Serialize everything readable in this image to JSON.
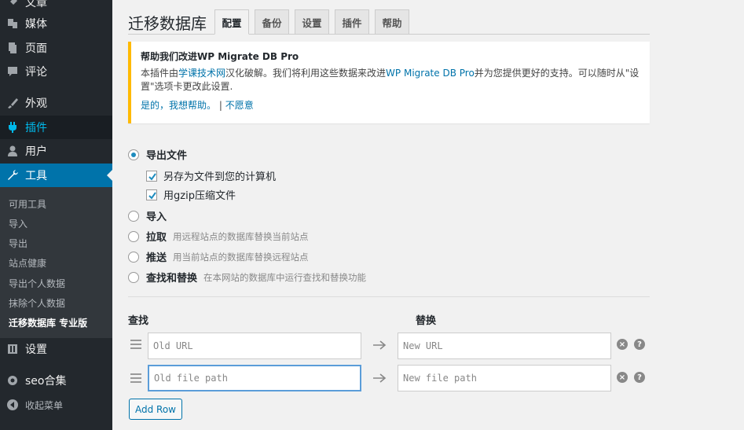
{
  "sidebar": {
    "items": [
      {
        "label": "文章"
      },
      {
        "label": "媒体"
      },
      {
        "label": "页面"
      },
      {
        "label": "评论"
      },
      {
        "label": "外观"
      },
      {
        "label": "插件"
      },
      {
        "label": "用户"
      },
      {
        "label": "工具"
      },
      {
        "label": "设置"
      },
      {
        "label": "seo合集"
      },
      {
        "label": "收起菜单"
      }
    ],
    "submenu": [
      {
        "label": "可用工具"
      },
      {
        "label": "导入"
      },
      {
        "label": "导出"
      },
      {
        "label": "站点健康"
      },
      {
        "label": "导出个人数据"
      },
      {
        "label": "抹除个人数据"
      },
      {
        "label": "迁移数据库 专业版"
      }
    ]
  },
  "page": {
    "title": "迁移数据库",
    "tabs": [
      {
        "label": "配置"
      },
      {
        "label": "备份"
      },
      {
        "label": "设置"
      },
      {
        "label": "插件"
      },
      {
        "label": "帮助"
      }
    ]
  },
  "notice": {
    "title": "帮助我们改进WP Migrate DB Pro",
    "text_1": "本插件由",
    "link_1": "学课技术网",
    "text_2": "汉化破解。我们将利用这些数据来改进",
    "link_2": "WP Migrate DB Pro",
    "text_3": "并为您提供更好的支持。可以随时从\"设置\"选项卡更改此设置.",
    "yes": "是的，我想帮助。",
    "separator": " | ",
    "no": "不愿意"
  },
  "options": {
    "export": {
      "label": "导出文件",
      "selected": true
    },
    "save_to_computer": {
      "label": "另存为文件到您的计算机",
      "checked": true
    },
    "gzip": {
      "label": "用gzip压缩文件",
      "checked": true
    },
    "import": {
      "label": "导入"
    },
    "pull": {
      "label": "拉取",
      "desc": "用远程站点的数据库替换当前站点"
    },
    "push": {
      "label": "推送",
      "desc": "用当前站点的数据库替换远程站点"
    },
    "find_replace": {
      "label": "查找和替换",
      "desc": "在本网站的数据库中运行查找和替换功能"
    }
  },
  "find_replace": {
    "find_header": "查找",
    "replace_header": "替换",
    "rows": [
      {
        "find_placeholder": "Old URL",
        "replace_placeholder": "New URL"
      },
      {
        "find_placeholder": "Old file path",
        "replace_placeholder": "New file path"
      }
    ],
    "remove_icon": "×",
    "help_icon": "?",
    "add_row": "Add Row"
  },
  "colors": {
    "sidebar_bg": "#23282d",
    "active_menu": "#0073aa",
    "link": "#0073aa",
    "notice_border": "#ffb900"
  }
}
